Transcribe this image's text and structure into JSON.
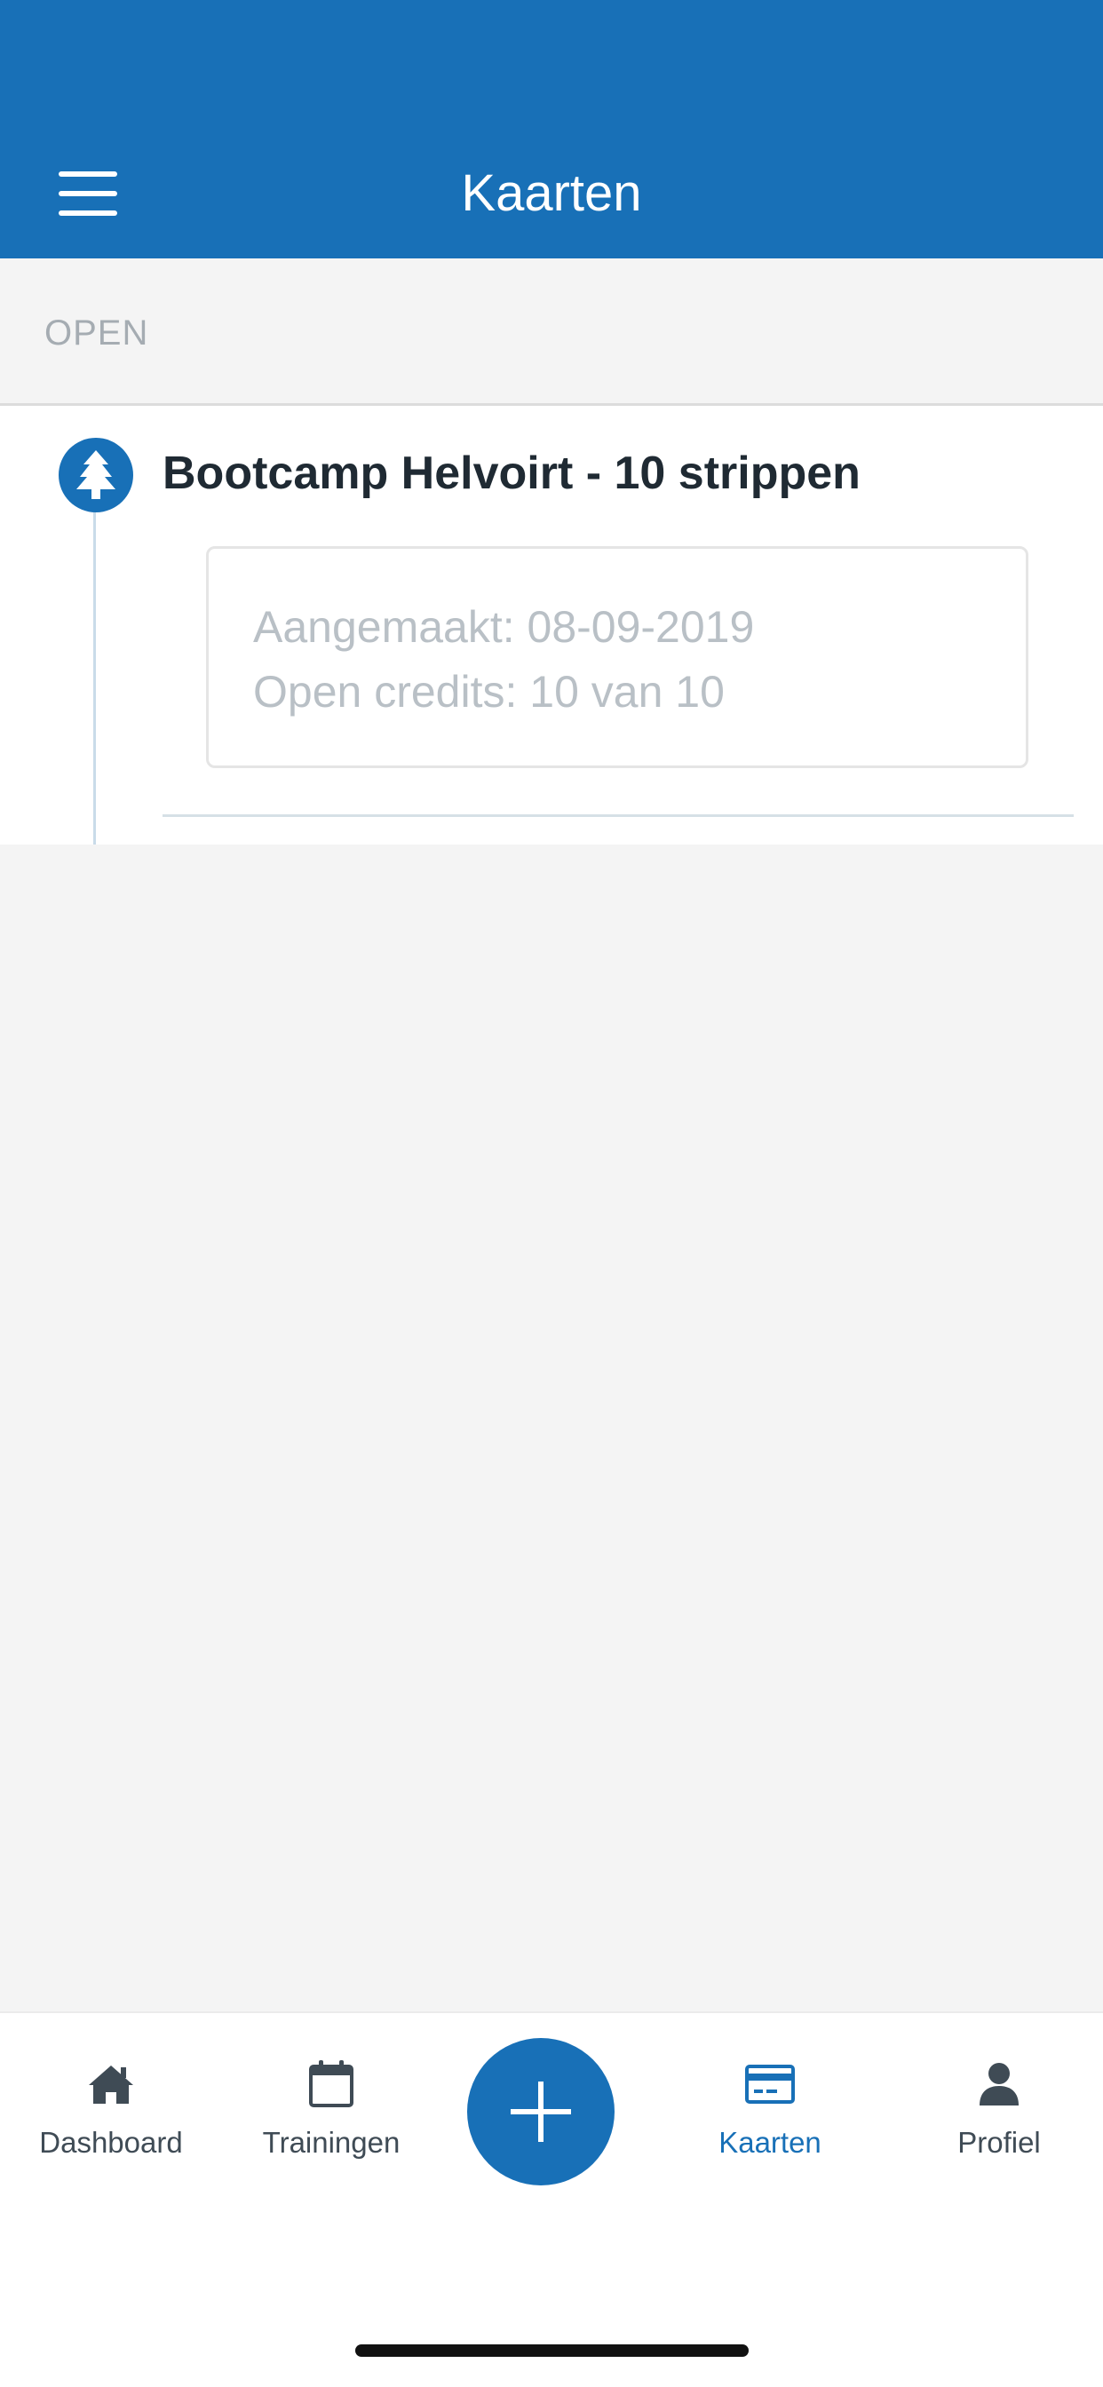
{
  "header": {
    "title": "Kaarten",
    "menu_icon": "hamburger-menu-icon",
    "background_color": "#1870b7"
  },
  "section": {
    "label": "OPEN"
  },
  "cards": [
    {
      "title": "Bootcamp Helvoirt - 10 strippen",
      "icon": "tree-icon",
      "created": "Aangemaakt: 08-09-2019",
      "credits": "Open credits: 10 van 10"
    }
  ],
  "tabbar": {
    "tabs": [
      {
        "label": "Dashboard",
        "icon": "home-icon",
        "active": false
      },
      {
        "label": "Trainingen",
        "icon": "calendar-icon",
        "active": false
      },
      {
        "label": "Kaarten",
        "icon": "credit-card-icon",
        "active": true
      },
      {
        "label": "Profiel",
        "icon": "user-icon",
        "active": false
      }
    ],
    "add_button_icon": "plus-icon",
    "active_color": "#1870b7",
    "inactive_color": "#3f4b55"
  }
}
